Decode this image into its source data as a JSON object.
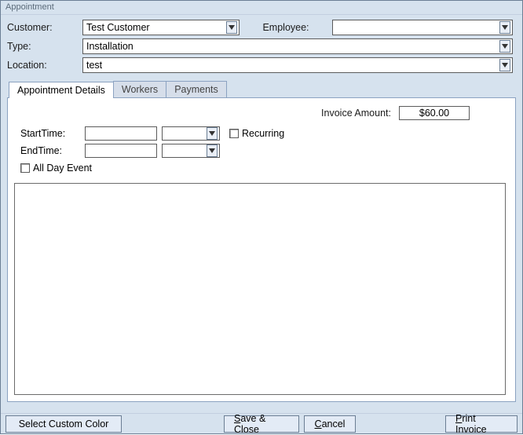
{
  "window": {
    "title": "Appointment"
  },
  "header": {
    "customer_label": "Customer:",
    "customer_value": "Test Customer",
    "employee_label": "Employee:",
    "employee_value": "",
    "type_label": "Type:",
    "type_value": "Installation",
    "location_label": "Location:",
    "location_value": "test"
  },
  "tabs": {
    "details": "Appointment Details",
    "workers": "Workers",
    "payments": "Payments"
  },
  "details": {
    "invoice_label": "Invoice Amount:",
    "invoice_value": "$60.00",
    "start_label": "StartTime:",
    "start_date": "",
    "start_time": "",
    "end_label": "EndTime:",
    "end_date": "",
    "end_time": "",
    "recurring_label": "Recurring",
    "allday_label": "All Day Event",
    "notes": ""
  },
  "footer": {
    "select_color": "Select Custom Color",
    "save_close_pre": "S",
    "save_close_post": "ave & Close",
    "cancel_pre": "C",
    "cancel_post": "ancel",
    "print_pre": "P",
    "print_post": "rint Invoice"
  }
}
